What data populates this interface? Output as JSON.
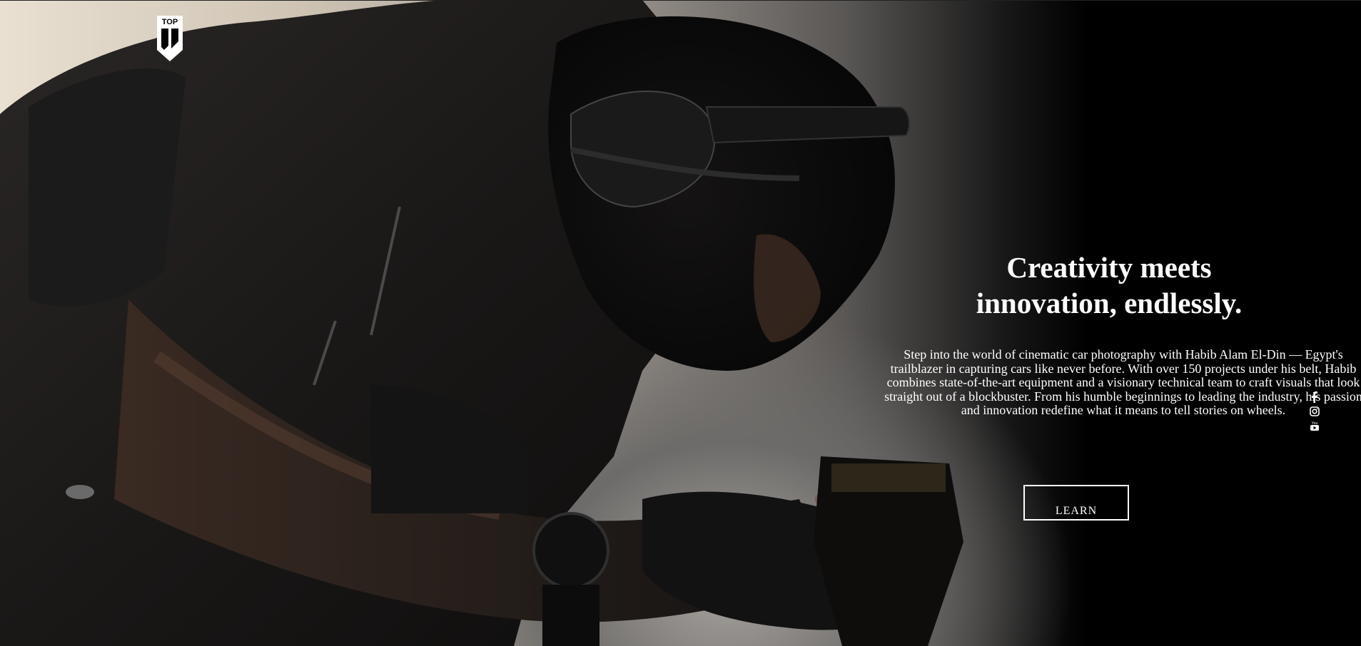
{
  "brand": {
    "logo_text": "TOP",
    "logo_icon": "shield-logo-icon"
  },
  "hero": {
    "headline_line1": "Creativity meets",
    "headline_line2": "innovation, endlessly.",
    "body": "Step into the world of cinematic car photography with Habib Alam El-Din — Egypt's trailblazer in capturing cars like never before. With over 150 projects under his belt, Habib combines state-of-the-art equipment and a visionary technical team to craft visuals that look straight out of a blockbuster. From his humble beginnings to leading the industry, his passion and innovation redefine what it means to tell stories on wheels.",
    "cta_label": "LEARN"
  },
  "social": {
    "items": [
      {
        "icon": "facebook-icon"
      },
      {
        "icon": "instagram-icon"
      },
      {
        "icon": "youtube-icon"
      }
    ]
  },
  "colors": {
    "background": "#000000",
    "text": "#ffffff",
    "warm_light": "#e9e0d2"
  }
}
